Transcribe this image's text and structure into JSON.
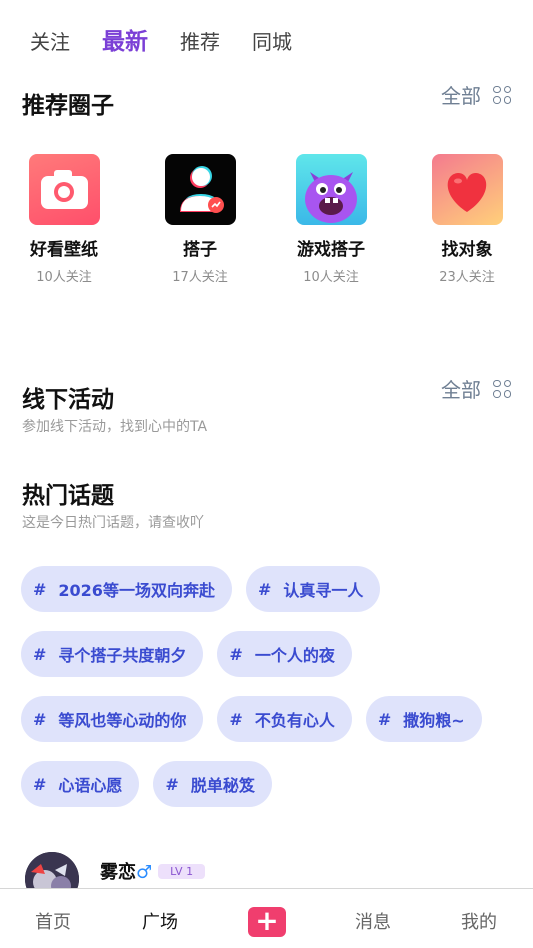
{
  "tabs": [
    {
      "label": "关注"
    },
    {
      "label": "最新"
    },
    {
      "label": "推荐"
    },
    {
      "label": "同城"
    }
  ],
  "recommended": {
    "title": "推荐圈子",
    "all_label": "全部",
    "circles": [
      {
        "name": "好看壁纸",
        "followers": "10人关注",
        "icon": "camera-icon"
      },
      {
        "name": "搭子",
        "followers": "17人关注",
        "icon": "people-icon"
      },
      {
        "name": "游戏搭子",
        "followers": "10人关注",
        "icon": "monster-icon"
      },
      {
        "name": "找对象",
        "followers": "23人关注",
        "icon": "heart-icon"
      }
    ]
  },
  "offline": {
    "title": "线下活动",
    "subtitle": "参加线下活动，找到心中的TA",
    "all_label": "全部"
  },
  "hot_topics": {
    "title": "热门话题",
    "subtitle": "这是今日热门话题，请查收吖",
    "hash": "#",
    "rows": [
      [
        "2026等一场双向奔赴",
        "认真寻一人"
      ],
      [
        "寻个搭子共度朝夕",
        "一个人的夜"
      ],
      [
        "等风也等心动的你",
        "不负有心人",
        "撒狗粮~"
      ],
      [
        "心语心愿",
        "脱单秘笈"
      ]
    ]
  },
  "post": {
    "username": "雾恋",
    "gender_symbol": "♂",
    "level": "LV 1"
  },
  "bottom_nav": {
    "home": "首页",
    "plaza": "广场",
    "plus": "+",
    "messages": "消息",
    "mine": "我的"
  },
  "colors": {
    "accent": "#7b3fd6",
    "topic_bg": "#dfe3fb",
    "topic_text": "#3a4bd0",
    "plus_button": "#f03e6e"
  }
}
